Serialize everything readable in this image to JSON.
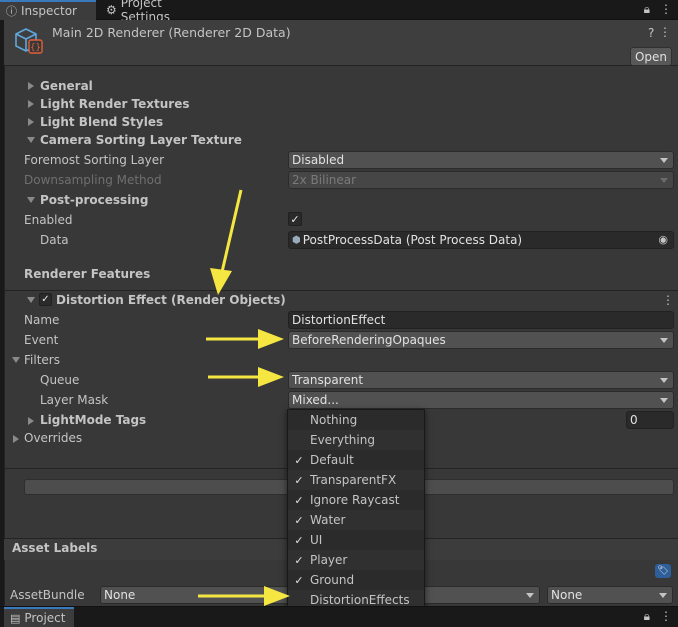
{
  "tabs": {
    "inspector": "Inspector",
    "project_settings": "Project Settings"
  },
  "header": {
    "title": "Main 2D Renderer (Renderer 2D Data)",
    "open_label": "Open",
    "help": "?",
    "menu": "⋮"
  },
  "sections": {
    "general": "General",
    "light_render_textures": "Light Render Textures",
    "light_blend_styles": "Light Blend Styles",
    "camera_sorting": "Camera Sorting Layer Texture",
    "post_processing": "Post-processing",
    "renderer_features": "Renderer Features"
  },
  "fields": {
    "foremost_label": "Foremost Sorting Layer",
    "foremost_value": "Disabled",
    "downsampling_label": "Downsampling Method",
    "downsampling_value": "2x Bilinear",
    "enabled_label": "Enabled",
    "data_label": "Data",
    "data_value": "PostProcessData (Post Process Data)"
  },
  "feature": {
    "title": "Distortion Effect (Render Objects)",
    "name_label": "Name",
    "name_value": "DistortionEffect",
    "event_label": "Event",
    "event_value": "BeforeRenderingOpaques",
    "filters_label": "Filters",
    "queue_label": "Queue",
    "queue_value": "Transparent",
    "layer_mask_label": "Layer Mask",
    "layer_mask_value": "Mixed...",
    "lightmode_label": "LightMode Tags",
    "lightmode_count": "0",
    "overrides_label": "Overrides"
  },
  "layer_menu": [
    {
      "label": "Nothing",
      "checked": false
    },
    {
      "label": "Everything",
      "checked": false
    },
    {
      "label": "Default",
      "checked": true
    },
    {
      "label": "TransparentFX",
      "checked": true
    },
    {
      "label": "Ignore Raycast",
      "checked": true
    },
    {
      "label": "Water",
      "checked": true
    },
    {
      "label": "UI",
      "checked": true
    },
    {
      "label": "Player",
      "checked": true
    },
    {
      "label": "Ground",
      "checked": true
    },
    {
      "label": "DistortionEffects",
      "checked": false
    }
  ],
  "asset": {
    "labels_title": "Asset Labels",
    "bundle_label": "AssetBundle",
    "bundle_value": "None",
    "variant_value": "None"
  },
  "bottom": {
    "project_tab": "Project"
  },
  "colors": {
    "accent": "#3a79bb",
    "annotation_arrow": "#f5e642"
  }
}
